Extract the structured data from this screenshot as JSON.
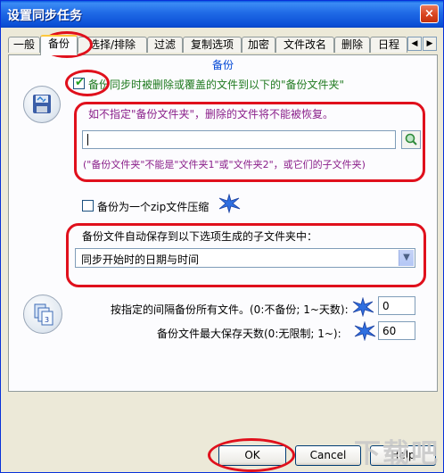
{
  "window": {
    "title": "设置同步任务",
    "close_label": "×"
  },
  "tabs": [
    "一般",
    "备份",
    "选择/排除",
    "过滤",
    "复制选项",
    "加密",
    "文件改名",
    "删除",
    "日程"
  ],
  "section_title": "备份",
  "backup": {
    "enable_label": "备份同步时被删除或覆盖的文件到以下的\"备份文件夹\"",
    "enable_checked": true,
    "hint_top": "如不指定\"备份文件夹\"，删除的文件将不能被恢复。",
    "path_value": "",
    "hint_bottom": "(\"备份文件夹\"不能是\"文件夹1\"或\"文件夹2\"，或它们的子文件夹)",
    "zip_label": "备份为一个zip文件压缩",
    "zip_checked": false,
    "subfolder_label": "备份文件自动保存到以下选项生成的子文件夹中：",
    "subfolder_selected": "同步开始时的日期与时间"
  },
  "interval": {
    "label": "按指定的间隔备份所有文件。(0:不备份; 1~天数):",
    "value": "0",
    "max_days_label": "备份文件最大保存天数(0:无限制; 1~):",
    "max_days_value": "60"
  },
  "buttons": {
    "ok": "OK",
    "cancel": "Cancel",
    "help": "Help"
  },
  "watermark": "下载吧",
  "colors": {
    "accent_red": "#e0101c",
    "section_blue": "#0046d5",
    "green": "#1f7a1f",
    "purple": "#8a1f8a"
  }
}
